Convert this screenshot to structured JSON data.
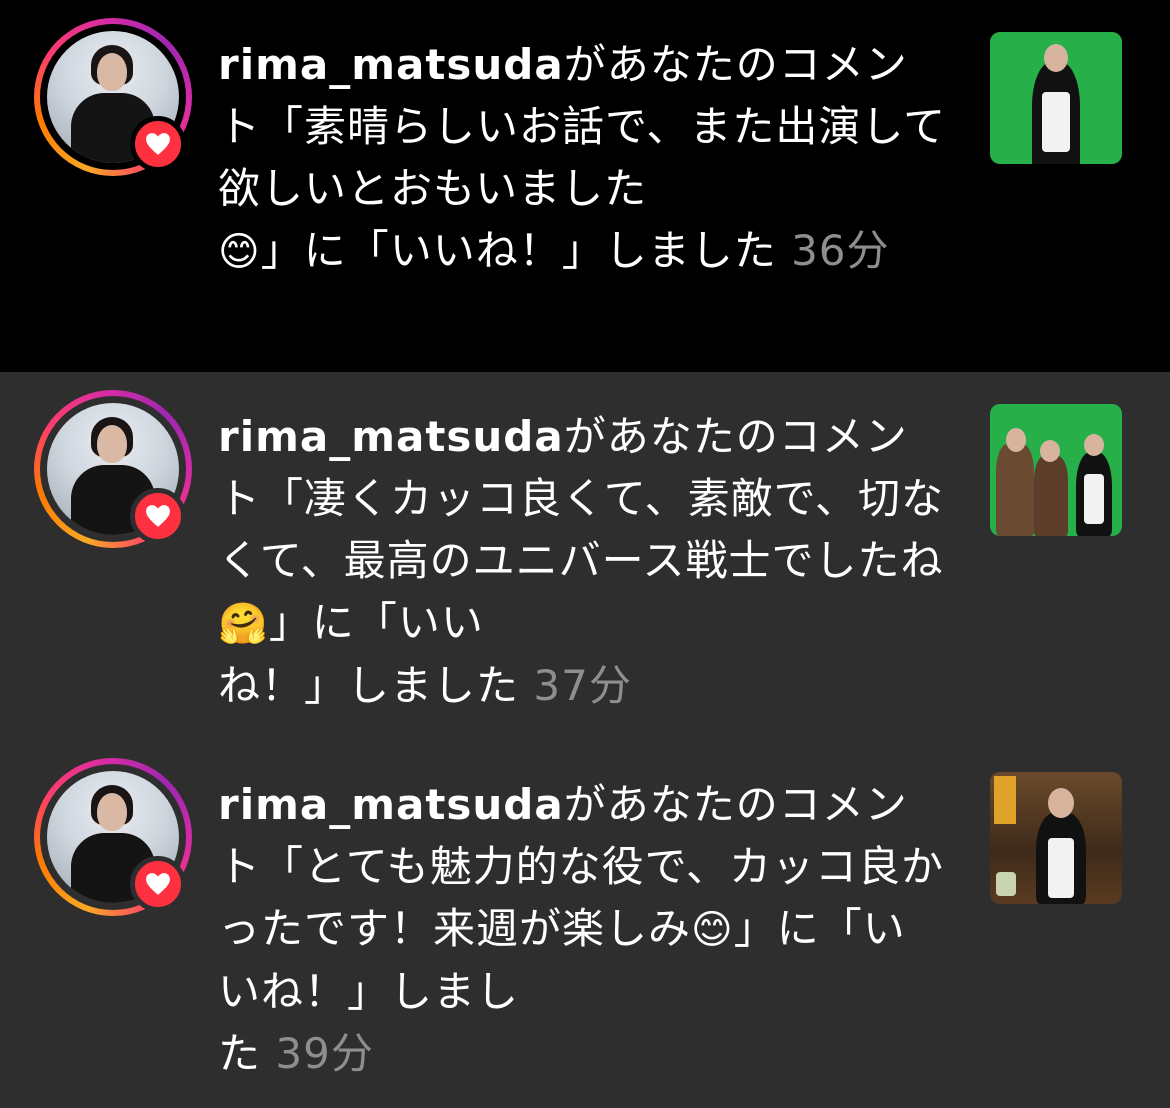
{
  "notifications": [
    {
      "username": "rima_matsuda",
      "message_lines": [
        "があなたのコメ",
        "ント「素晴らしいお話で、また",
        "出演して欲しいとおもいました",
        "」に「いいね！」しました"
      ],
      "emoji": "😊",
      "time": "36分",
      "liked": true,
      "avatar": "profile-photo",
      "thumbnail": "green-screen-maid-photo"
    },
    {
      "username": "rima_matsuda",
      "message_lines": [
        "があなたのコメ",
        "ント「凄くカッコ良くて、素敵",
        "で、切なくて、最高のユニバー",
        "ス戦士でしたね",
        "」に「いい",
        "ね！」しました"
      ],
      "emoji": "🤗",
      "time": "37分",
      "liked": true,
      "avatar": "profile-photo",
      "thumbnail": "green-screen-group-photo"
    },
    {
      "username": "rima_matsuda",
      "message_lines": [
        "があなたのコメ",
        "ント「とても魅力的な役で、カ",
        "ッコ良かったです！来週が楽し",
        "み",
        "」に「いいね！」しまし",
        "た"
      ],
      "emoji": "😊",
      "time": "39分",
      "liked": true,
      "avatar": "profile-photo",
      "thumbnail": "maid-interior-photo"
    }
  ],
  "colors": {
    "like_badge": "#ff3040",
    "time_text": "#8e8e8e",
    "unread_bg": "#000000",
    "read_bg": "#2e2e2e"
  }
}
